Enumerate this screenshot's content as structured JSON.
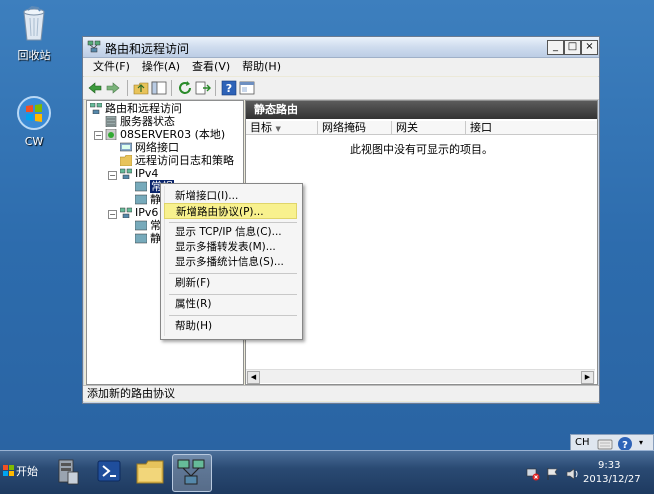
{
  "desktop": {
    "icons": [
      {
        "name": "recycle-bin",
        "label": "回收站"
      },
      {
        "name": "cw-shortcut",
        "label": "CW"
      }
    ]
  },
  "window": {
    "title": "路由和远程访问",
    "buttons": {
      "minimize": "_",
      "maximize": "□",
      "close": "×"
    },
    "menu": [
      "文件(F)",
      "操作(A)",
      "查看(V)",
      "帮助(H)"
    ]
  },
  "tree": {
    "root": "路由和远程访问",
    "server_status": "服务器状态",
    "server": "08SERVER03 (本地)",
    "net_interfaces": "网络接口",
    "remote_log": "远程访问日志和策略",
    "ipv4": "IPv4",
    "ipv4_child1": "常规",
    "ipv4_child2": "静",
    "ipv6": "IPv6",
    "ipv6_child1": "常",
    "ipv6_child2": "静"
  },
  "details": {
    "header": "静态路由",
    "columns": [
      "目标",
      "网络掩码",
      "网关",
      "接口"
    ],
    "empty_message": "此视图中没有可显示的项目。"
  },
  "context_menu": {
    "items": [
      "新增接口(I)...",
      "新增路由协议(P)...",
      "显示 TCP/IP 信息(C)...",
      "显示多播转发表(M)...",
      "显示多播统计信息(S)...",
      "刷新(F)",
      "属性(R)",
      "帮助(H)"
    ],
    "highlighted_index": 1
  },
  "status_bar": "添加新的路由协议",
  "taskbar": {
    "start_label": "开始",
    "language": "CH",
    "time": "9:33",
    "date": "2013/12/27"
  },
  "colors": {
    "accent": "#0a246a",
    "highlight": "#f8f18e",
    "desktop": "#2d6cad"
  }
}
